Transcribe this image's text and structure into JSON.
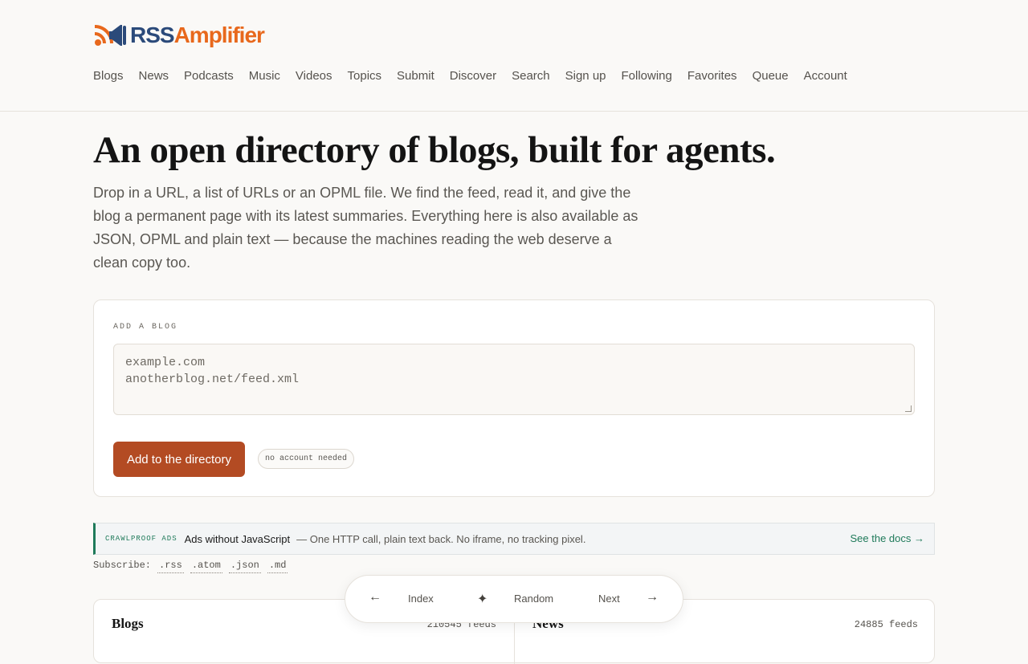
{
  "brand": {
    "rss": "RSS",
    "amp": "Amplifier",
    "icon": "megaphone-icon"
  },
  "nav": [
    "Blogs",
    "News",
    "Podcasts",
    "Music",
    "Videos",
    "Topics",
    "Submit",
    "Discover",
    "Search",
    "Sign up",
    "Following",
    "Favorites",
    "Queue",
    "Account"
  ],
  "hero": {
    "title": "An open directory of blogs, built for agents.",
    "subtitle": "Drop in a URL, a list of URLs or an OPML file. We find the feed, read it, and give the blog a permanent page with its latest summaries. Everything here is also available as JSON, OPML and plain text — because the machines reading the web deserve a clean copy too."
  },
  "add_blog": {
    "label": "ADD A BLOG",
    "placeholder": "example.com\nanotherblog.net/feed.xml",
    "button": "Add to the directory",
    "pill": "no account needed"
  },
  "ad": {
    "tag": "CRAWLPROOF ADS",
    "title": "Ads without JavaScript",
    "desc": "— One HTTP call, plain text back. No iframe, no tracking pixel.",
    "link": "See the docs →"
  },
  "subscribe": {
    "label": "Subscribe:",
    "formats": [
      ".rss",
      ".atom",
      ".json",
      ".md"
    ]
  },
  "feeds": [
    {
      "name": "Blogs",
      "count": "210545 feeds"
    },
    {
      "name": "News",
      "count": "24885 feeds"
    }
  ],
  "floatbar": {
    "prev_arrow": "←",
    "index": "Index",
    "star": "✦",
    "random": "Random",
    "next": "Next",
    "next_arrow": "→"
  },
  "colors": {
    "accent": "#b34b23",
    "brand_blue": "#2b4a7a",
    "brand_orange": "#e8681c",
    "ad_green": "#1f7a5a"
  }
}
